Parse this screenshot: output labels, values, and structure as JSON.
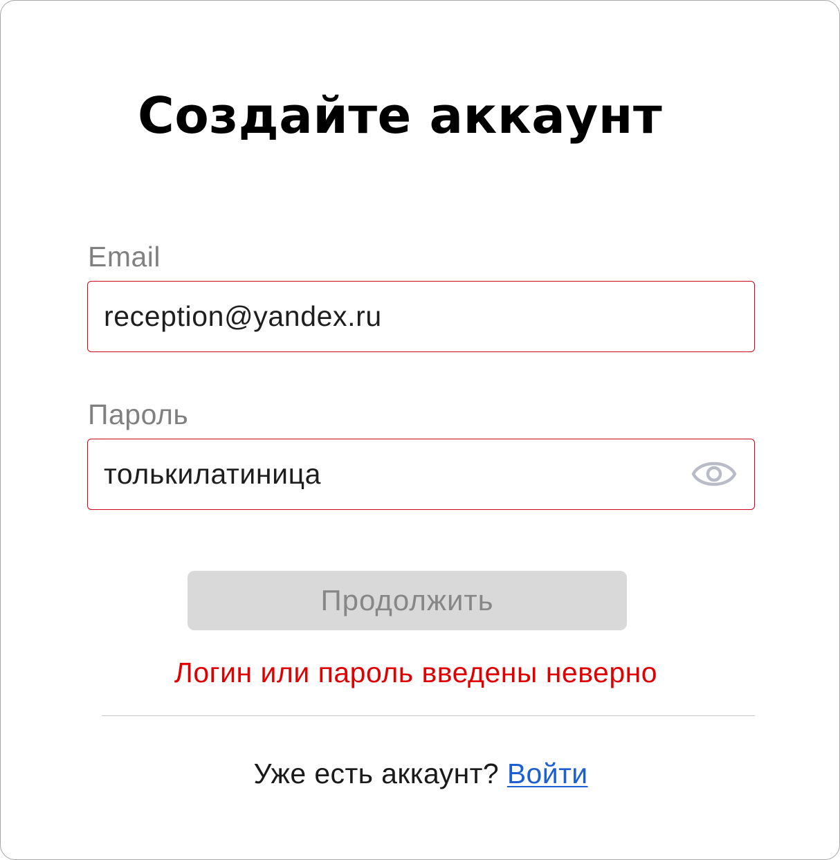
{
  "form": {
    "title": "Создайте аккаунт",
    "email": {
      "label": "Email",
      "value": "reception@yandex.ru"
    },
    "password": {
      "label": "Пароль",
      "value": "толькилатиница",
      "toggle_icon": "eye-icon"
    },
    "submit_label": "Продолжить",
    "error_message": "Логин или пароль введены неверно",
    "footer": {
      "prompt": "Уже есть аккаунт? ",
      "login_link": "Войти"
    }
  },
  "colors": {
    "error": "#e00000",
    "field_border_error": "#d0021b",
    "button_disabled_bg": "#d9d9d9",
    "button_disabled_text": "#878787",
    "link": "#1b5fd1",
    "label": "#808080"
  }
}
